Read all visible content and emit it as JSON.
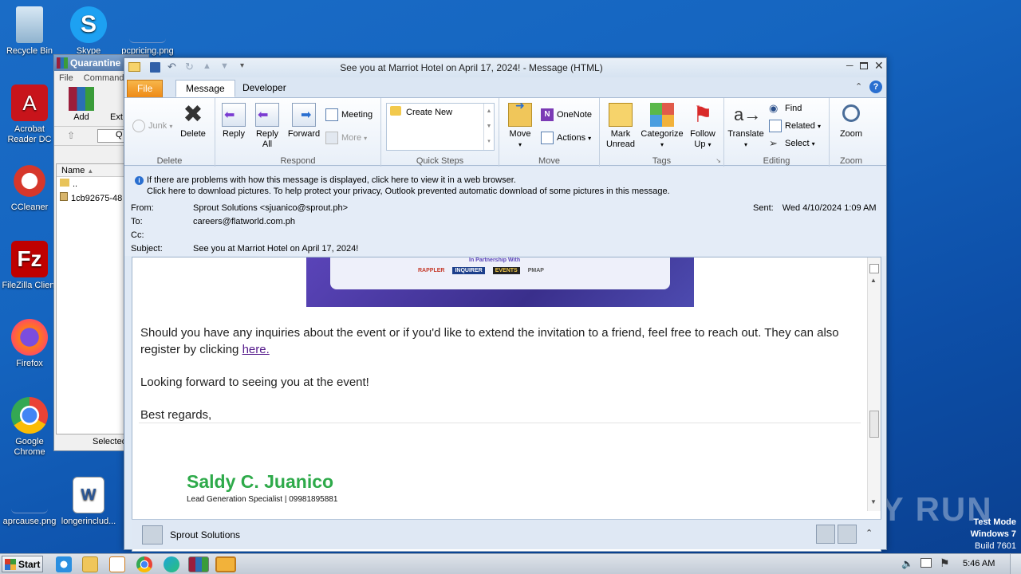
{
  "desktop": {
    "icons": [
      {
        "label": "Recycle Bin"
      },
      {
        "label": "Skype"
      },
      {
        "label": "pcpricing.png"
      },
      {
        "label": "Acrobat Reader DC"
      },
      {
        "label": "CCleaner"
      },
      {
        "label": "FileZilla Client"
      },
      {
        "label": "Firefox"
      },
      {
        "label": "Google Chrome"
      },
      {
        "label": "aprcause.png"
      },
      {
        "label": "longerinclud..."
      }
    ],
    "watermark": {
      "brand": "ANY RUN",
      "line1": "Test Mode",
      "line2": "Windows 7",
      "line3": "Build 7601"
    }
  },
  "winrar": {
    "title": "Quarantine",
    "menu": [
      "File",
      "Commands"
    ],
    "toolbar": [
      "Add",
      "Ext"
    ],
    "path": "Q",
    "col_name": "Name",
    "rows": [
      "..",
      "1cb92675-48"
    ],
    "status": "Selected"
  },
  "outlook": {
    "title": "See you at Marriot Hotel on April 17, 2024!  -  Message (HTML)",
    "tabs": [
      "File",
      "Message",
      "Developer"
    ],
    "ribbon": {
      "delete": {
        "label": "Delete",
        "junk": "Junk",
        "delete": "Delete"
      },
      "respond": {
        "label": "Respond",
        "reply": "Reply",
        "reply_all": "Reply All",
        "forward": "Forward",
        "meeting": "Meeting",
        "more": "More"
      },
      "quick_steps": {
        "label": "Quick Steps",
        "create_new": "Create New"
      },
      "move": {
        "label": "Move",
        "move": "Move",
        "onenote": "OneNote",
        "actions": "Actions"
      },
      "tags": {
        "label": "Tags",
        "mark_unread": "Mark Unread",
        "categorize": "Categorize",
        "follow_up": "Follow Up"
      },
      "editing": {
        "label": "Editing",
        "translate": "Translate",
        "find": "Find",
        "related": "Related",
        "select": "Select"
      },
      "zoom": {
        "label": "Zoom",
        "zoom": "Zoom"
      }
    },
    "info_line1": "If there are problems with how this message is displayed, click here to view it in a web browser.",
    "info_line2": "Click here to download pictures. To help protect your privacy, Outlook prevented automatic download of some pictures in this message.",
    "header": {
      "from_label": "From:",
      "from": "Sprout Solutions <sjuanico@sprout.ph>",
      "to_label": "To:",
      "to": "careers@flatworld.com.ph",
      "cc_label": "Cc:",
      "cc": "",
      "subject_label": "Subject:",
      "subject": "See you at Marriot Hotel on April 17, 2024!",
      "sent_label": "Sent:",
      "sent": "Wed 4/10/2024 1:09 AM"
    },
    "banner": {
      "partnership": "In Partnership With",
      "logos": [
        "RAPPLER",
        "INQUIRER",
        "EVENTS",
        "PMAP"
      ]
    },
    "body": {
      "para1": "Should you have any inquiries about the event or if you'd like to extend the invitation to a friend, feel free to reach out. They can also register by clicking",
      "link": "here.",
      "para2": "Looking forward to seeing you at the event!",
      "para3": "Best regards,",
      "sig_name": "Saldy C. Juanico",
      "sig_title": "Lead Generation Specialist | 09981895881"
    },
    "people_pane": "Sprout Solutions"
  },
  "taskbar": {
    "start": "Start",
    "clock": "5:46 AM"
  }
}
